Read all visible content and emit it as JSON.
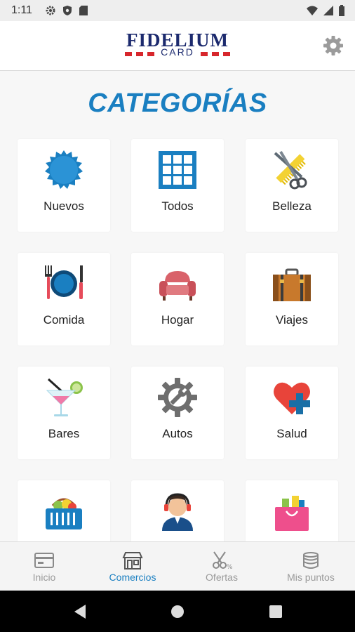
{
  "status_bar": {
    "time": "1:11",
    "left_icons": [
      "settings-icon",
      "shield-icon",
      "sd-card-icon"
    ],
    "right_icons": [
      "wifi-icon",
      "signal-icon",
      "battery-icon"
    ]
  },
  "app_bar": {
    "logo_word": "FIDELIUM",
    "logo_subword": "CARD",
    "settings_icon": "gear-icon"
  },
  "page": {
    "title": "CATEGORÍAS"
  },
  "categories": [
    {
      "label": "Nuevos",
      "icon": "new-badge-icon"
    },
    {
      "label": "Todos",
      "icon": "grid-icon"
    },
    {
      "label": "Belleza",
      "icon": "scissors-comb-icon"
    },
    {
      "label": "Comida",
      "icon": "plate-cutlery-icon"
    },
    {
      "label": "Hogar",
      "icon": "sofa-icon"
    },
    {
      "label": "Viajes",
      "icon": "suitcase-icon"
    },
    {
      "label": "Bares",
      "icon": "cocktail-icon"
    },
    {
      "label": "Autos",
      "icon": "gear-wrench-icon"
    },
    {
      "label": "Salud",
      "icon": "heart-cross-icon"
    },
    {
      "label": "",
      "icon": "basket-icon"
    },
    {
      "label": "",
      "icon": "support-agent-icon"
    },
    {
      "label": "",
      "icon": "shopping-bag-icon"
    }
  ],
  "bottom_nav": [
    {
      "label": "Inicio",
      "icon": "home-card-icon",
      "active": false
    },
    {
      "label": "Comercios",
      "icon": "store-icon",
      "active": true
    },
    {
      "label": "Ofertas",
      "icon": "scissors-coupon-icon",
      "active": false
    },
    {
      "label": "Mis puntos",
      "icon": "coins-icon",
      "active": false
    }
  ],
  "colors": {
    "accent": "#1a7fc1",
    "logo_blue": "#1c2a6e",
    "logo_red": "#d7262c"
  }
}
